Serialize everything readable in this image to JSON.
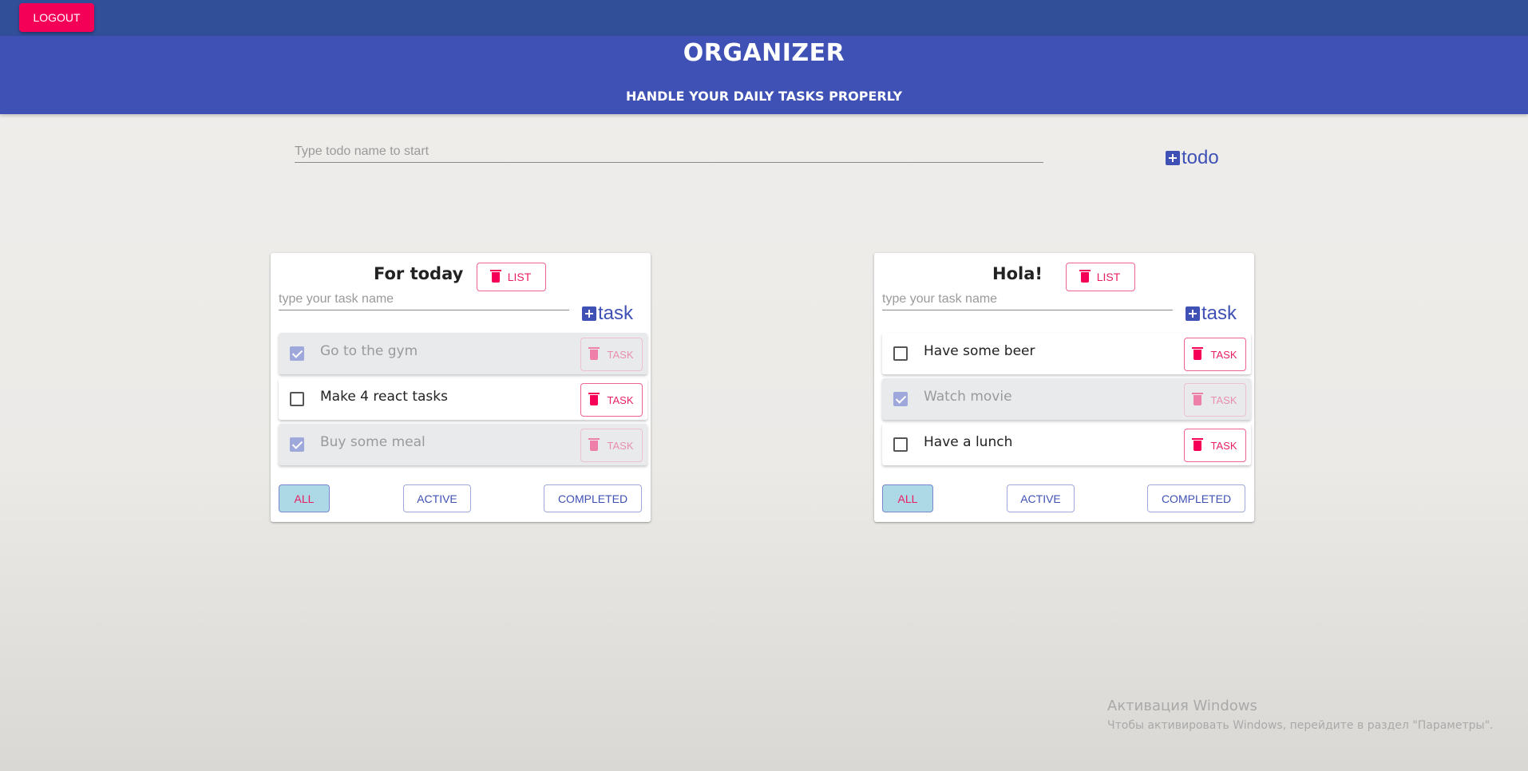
{
  "topbar": {
    "logout_label": "Logout"
  },
  "header": {
    "title": "ORGANIZER",
    "subtitle": "HANDLE YOUR DAILY TASKS PROPERLY"
  },
  "new_todo": {
    "placeholder": "Type todo name to start",
    "add_label": "todo"
  },
  "lists": [
    {
      "title": "For today",
      "delete_list_label": "list",
      "task_placeholder": "type your task name",
      "add_task_label": "task",
      "tasks": [
        {
          "label": "Go to the gym",
          "completed": true,
          "delete_label": "task"
        },
        {
          "label": "Make 4 react tasks",
          "completed": false,
          "delete_label": "task"
        },
        {
          "label": "Buy some meal",
          "completed": true,
          "delete_label": "task"
        }
      ],
      "filters": {
        "all": "all",
        "active": "active",
        "completed": "completed",
        "selected": "all"
      }
    },
    {
      "title": "Hola!",
      "delete_list_label": "list",
      "task_placeholder": "type your task name",
      "add_task_label": "task",
      "tasks": [
        {
          "label": "Have some beer",
          "completed": false,
          "delete_label": "task"
        },
        {
          "label": "Watch movie",
          "completed": true,
          "delete_label": "task"
        },
        {
          "label": "Have a lunch",
          "completed": false,
          "delete_label": "task"
        }
      ],
      "filters": {
        "all": "all",
        "active": "active",
        "completed": "completed",
        "selected": "all"
      }
    }
  ],
  "watermark": {
    "line1": "Активация Windows",
    "line2": "Чтобы активировать Windows, перейдите в раздел \"Параметры\"."
  },
  "colors": {
    "topbar": "#314e99",
    "header": "#3f51b5",
    "accent_pink": "#f50057",
    "checked": "#9fa8da",
    "filter_selected": "#add8e6"
  },
  "icons": {
    "add": "plus-square-icon",
    "delete": "trash-icon",
    "checkbox": "checkbox-icon"
  }
}
